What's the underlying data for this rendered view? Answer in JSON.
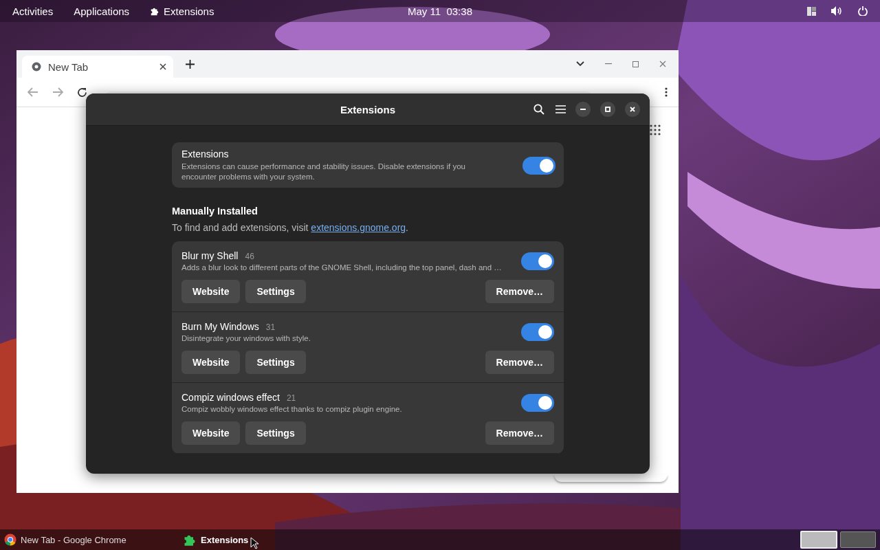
{
  "top_bar": {
    "activities": "Activities",
    "applications": "Applications",
    "app_menu": "Extensions",
    "clock": "May 11  03:38"
  },
  "browser": {
    "tab": {
      "title": "New Tab",
      "selected": true
    }
  },
  "extensions_window": {
    "title": "Extensions",
    "master": {
      "title": "Extensions",
      "description": "Extensions can cause performance and stability issues. Disable extensions if you encounter problems with your system.",
      "on": true
    },
    "section": {
      "heading": "Manually Installed",
      "text_before": "To find and add extensions, visit ",
      "link": "extensions.gnome.org",
      "text_after": "."
    },
    "extensions": [
      {
        "name": "Blur my Shell",
        "version": "46",
        "description": "Adds a blur look to different parts of the GNOME Shell, including the top panel, dash and …",
        "on": true,
        "buttons": [
          "Website",
          "Settings"
        ],
        "remove": "Remove…"
      },
      {
        "name": "Burn My Windows",
        "version": "31",
        "description": "Disintegrate your windows with style.",
        "on": true,
        "buttons": [
          "Website",
          "Settings"
        ],
        "remove": "Remove…"
      },
      {
        "name": "Compiz windows effect",
        "version": "21",
        "description": "Compiz wobbly windows effect thanks to compiz plugin engine.",
        "on": true,
        "buttons": [
          "Website",
          "Settings"
        ],
        "remove": "Remove…"
      }
    ]
  },
  "taskbar": {
    "items": [
      {
        "label": "New Tab - Google Chrome",
        "kind": "chrome",
        "selected": false
      },
      {
        "label": "Extensions",
        "kind": "puzzle",
        "selected": true
      }
    ],
    "workspaces": [
      {
        "selected": true
      },
      {
        "selected": false
      }
    ]
  }
}
